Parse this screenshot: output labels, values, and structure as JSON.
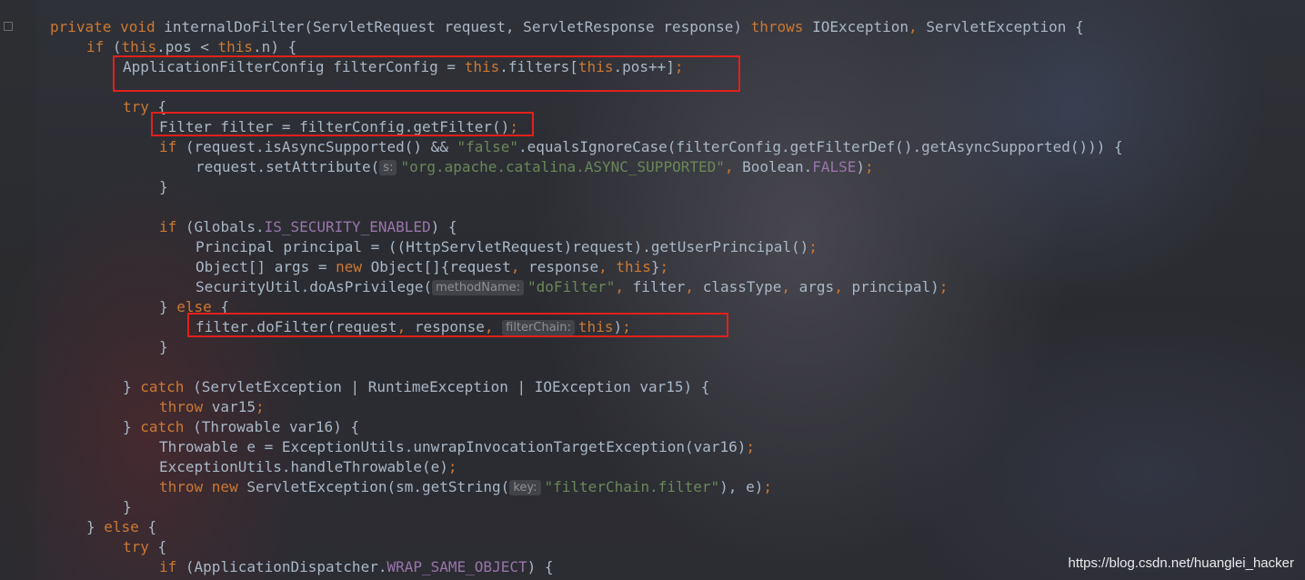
{
  "code_lines": [
    {
      "indent": 0,
      "tokens": [
        [
          "kw",
          "private void "
        ],
        [
          "p",
          "internalDoFilter(ServletRequest request, ServletResponse response) "
        ],
        [
          "kw",
          "throws "
        ],
        [
          "p",
          "IOException"
        ],
        [
          "kw",
          ", "
        ],
        [
          "p",
          "ServletException {"
        ]
      ]
    },
    {
      "indent": 1,
      "tokens": [
        [
          "kw",
          "if "
        ],
        [
          "p",
          "("
        ],
        [
          "kw",
          "this"
        ],
        [
          "p",
          ".pos < "
        ],
        [
          "kw",
          "this"
        ],
        [
          "p",
          ".n) {"
        ]
      ]
    },
    {
      "indent": 2,
      "tokens": [
        [
          "p",
          "ApplicationFilterConfig filterConfig = "
        ],
        [
          "kw",
          "this"
        ],
        [
          "p",
          ".filters["
        ],
        [
          "kw",
          "this"
        ],
        [
          "p",
          ".pos++]"
        ],
        [
          "kw",
          ";"
        ]
      ]
    },
    {
      "indent": 0,
      "tokens": []
    },
    {
      "indent": 2,
      "tokens": [
        [
          "kw",
          "try "
        ],
        [
          "p",
          "{"
        ]
      ]
    },
    {
      "indent": 3,
      "tokens": [
        [
          "p",
          "Filter filter = filterConfig.getFilter()"
        ],
        [
          "kw",
          ";"
        ]
      ]
    },
    {
      "indent": 3,
      "tokens": [
        [
          "kw",
          "if "
        ],
        [
          "p",
          "(request.isAsyncSupported() && "
        ],
        [
          "str",
          "\"false\""
        ],
        [
          "p",
          ".equalsIgnoreCase(filterConfig.getFilterDef().getAsyncSupported())) {"
        ]
      ]
    },
    {
      "indent": 4,
      "tokens": [
        [
          "p",
          "request.setAttribute("
        ],
        [
          "hint",
          "s:"
        ],
        [
          "str",
          "\"org.apache.catalina.ASYNC_SUPPORTED\""
        ],
        [
          "kw",
          ", "
        ],
        [
          "p",
          "Boolean."
        ],
        [
          "fld",
          "FALSE"
        ],
        [
          "p",
          ")"
        ],
        [
          "kw",
          ";"
        ]
      ]
    },
    {
      "indent": 3,
      "tokens": [
        [
          "p",
          "}"
        ]
      ]
    },
    {
      "indent": 0,
      "tokens": []
    },
    {
      "indent": 3,
      "tokens": [
        [
          "kw",
          "if "
        ],
        [
          "p",
          "(Globals."
        ],
        [
          "fld",
          "IS_SECURITY_ENABLED"
        ],
        [
          "p",
          ") {"
        ]
      ]
    },
    {
      "indent": 4,
      "tokens": [
        [
          "p",
          "Principal principal = ((HttpServletRequest)request).getUserPrincipal()"
        ],
        [
          "kw",
          ";"
        ]
      ]
    },
    {
      "indent": 4,
      "tokens": [
        [
          "p",
          "Object[] args = "
        ],
        [
          "kw",
          "new "
        ],
        [
          "p",
          "Object[]{request"
        ],
        [
          "kw",
          ", "
        ],
        [
          "p",
          "response"
        ],
        [
          "kw",
          ", this"
        ],
        [
          "p",
          "}"
        ],
        [
          "kw",
          ";"
        ]
      ]
    },
    {
      "indent": 4,
      "tokens": [
        [
          "p",
          "SecurityUtil.doAsPrivilege("
        ],
        [
          "hint",
          "methodName:"
        ],
        [
          "str",
          "\"doFilter\""
        ],
        [
          "kw",
          ", "
        ],
        [
          "p",
          "filter"
        ],
        [
          "kw",
          ", "
        ],
        [
          "p",
          "classType"
        ],
        [
          "kw",
          ", "
        ],
        [
          "p",
          "args"
        ],
        [
          "kw",
          ", "
        ],
        [
          "p",
          "principal)"
        ],
        [
          "kw",
          ";"
        ]
      ]
    },
    {
      "indent": 3,
      "tokens": [
        [
          "p",
          "} "
        ],
        [
          "kw",
          "else "
        ],
        [
          "p",
          "{"
        ]
      ]
    },
    {
      "indent": 4,
      "tokens": [
        [
          "p",
          "filter.doFilter(request"
        ],
        [
          "kw",
          ", "
        ],
        [
          "p",
          "response"
        ],
        [
          "kw",
          ", "
        ],
        [
          "hint",
          "filterChain:"
        ],
        [
          "kw",
          "this"
        ],
        [
          "p",
          ")"
        ],
        [
          "kw",
          ";"
        ]
      ]
    },
    {
      "indent": 3,
      "tokens": [
        [
          "p",
          "}"
        ]
      ]
    },
    {
      "indent": 0,
      "tokens": []
    },
    {
      "indent": 2,
      "tokens": [
        [
          "p",
          "} "
        ],
        [
          "kw",
          "catch "
        ],
        [
          "p",
          "(ServletException | RuntimeException | IOException var15) {"
        ]
      ]
    },
    {
      "indent": 3,
      "tokens": [
        [
          "kw",
          "throw "
        ],
        [
          "p",
          "var15"
        ],
        [
          "kw",
          ";"
        ]
      ]
    },
    {
      "indent": 2,
      "tokens": [
        [
          "p",
          "} "
        ],
        [
          "kw",
          "catch "
        ],
        [
          "p",
          "(Throwable var16) {"
        ]
      ]
    },
    {
      "indent": 3,
      "tokens": [
        [
          "p",
          "Throwable e = ExceptionUtils.unwrapInvocationTargetException(var16)"
        ],
        [
          "kw",
          ";"
        ]
      ]
    },
    {
      "indent": 3,
      "tokens": [
        [
          "p",
          "ExceptionUtils.handleThrowable(e)"
        ],
        [
          "kw",
          ";"
        ]
      ]
    },
    {
      "indent": 3,
      "tokens": [
        [
          "kw",
          "throw new "
        ],
        [
          "p",
          "ServletException(sm.getString("
        ],
        [
          "hint",
          "key:"
        ],
        [
          "str",
          "\"filterChain.filter\""
        ],
        [
          "p",
          "), e)"
        ],
        [
          "kw",
          ";"
        ]
      ]
    },
    {
      "indent": 2,
      "tokens": [
        [
          "p",
          "}"
        ]
      ]
    },
    {
      "indent": 1,
      "tokens": [
        [
          "p",
          "} "
        ],
        [
          "kw",
          "else "
        ],
        [
          "p",
          "{"
        ]
      ]
    },
    {
      "indent": 2,
      "tokens": [
        [
          "kw",
          "try "
        ],
        [
          "p",
          "{"
        ]
      ]
    },
    {
      "indent": 3,
      "tokens": [
        [
          "kw",
          "if "
        ],
        [
          "p",
          "(ApplicationDispatcher."
        ],
        [
          "fld",
          "WRAP_SAME_OBJECT"
        ],
        [
          "p",
          ") {"
        ]
      ]
    }
  ],
  "watermark": "https://blog.csdn.net/huanglei_hacker",
  "colors": {
    "keyword": "#cc7832",
    "plain": "#a9b7c6",
    "string": "#6a8759",
    "field": "#9876aa",
    "highlight_box": "#e3201b"
  }
}
